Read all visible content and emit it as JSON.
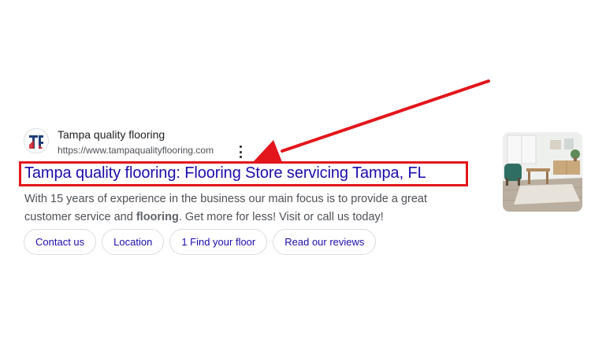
{
  "result": {
    "site_name": "Tampa quality flooring",
    "url": "https://www.tampaqualityflooring.com",
    "title": "Tampa quality flooring: Flooring Store servicing Tampa, FL",
    "snippet_part1": "With 15 years of experience in the business our main focus is to provide a great customer service and ",
    "snippet_bold": "flooring",
    "snippet_part2": ". Get more for less! Visit or call us today!",
    "sitelinks": [
      {
        "label": "Contact us"
      },
      {
        "label": "Location"
      },
      {
        "label": "1 Find your floor"
      },
      {
        "label": "Read our reviews"
      }
    ],
    "icons": {
      "favicon": "tampa-quality-flooring-logo-icon",
      "more": "more-vertical-icon"
    }
  },
  "annotation": {
    "color": "#e3161c"
  },
  "colors": {
    "link": "#1a0dab",
    "text": "#4d5156",
    "border": "#dadce0"
  }
}
